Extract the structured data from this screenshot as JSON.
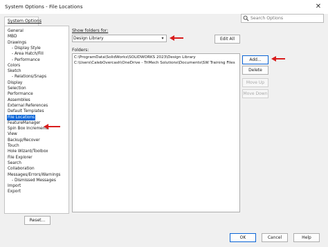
{
  "window": {
    "title": "System Options - File Locations",
    "close_glyph": "✕"
  },
  "tab": {
    "label": "System Options"
  },
  "search": {
    "placeholder": "Search Options"
  },
  "tree": {
    "items": [
      {
        "label": "General",
        "level": 0,
        "selected": false
      },
      {
        "label": "MBD",
        "level": 0,
        "selected": false
      },
      {
        "label": "Drawings",
        "level": 0,
        "selected": false
      },
      {
        "label": "Display Style",
        "level": 1,
        "selected": false
      },
      {
        "label": "Area Hatch/Fill",
        "level": 1,
        "selected": false
      },
      {
        "label": "Performance",
        "level": 1,
        "selected": false
      },
      {
        "label": "Colors",
        "level": 0,
        "selected": false
      },
      {
        "label": "Sketch",
        "level": 0,
        "selected": false
      },
      {
        "label": "Relations/Snaps",
        "level": 1,
        "selected": false
      },
      {
        "label": "Display",
        "level": 0,
        "selected": false
      },
      {
        "label": "Selection",
        "level": 0,
        "selected": false
      },
      {
        "label": "Performance",
        "level": 0,
        "selected": false
      },
      {
        "label": "Assemblies",
        "level": 0,
        "selected": false
      },
      {
        "label": "External References",
        "level": 0,
        "selected": false
      },
      {
        "label": "Default Templates",
        "level": 0,
        "selected": false
      },
      {
        "label": "File Locations",
        "level": 0,
        "selected": true
      },
      {
        "label": "FeatureManager",
        "level": 0,
        "selected": false
      },
      {
        "label": "Spin Box Increments",
        "level": 0,
        "selected": false
      },
      {
        "label": "View",
        "level": 0,
        "selected": false
      },
      {
        "label": "Backup/Recover",
        "level": 0,
        "selected": false
      },
      {
        "label": "Touch",
        "level": 0,
        "selected": false
      },
      {
        "label": "Hole Wizard/Toolbox",
        "level": 0,
        "selected": false
      },
      {
        "label": "File Explorer",
        "level": 0,
        "selected": false
      },
      {
        "label": "Search",
        "level": 0,
        "selected": false
      },
      {
        "label": "Collaboration",
        "level": 0,
        "selected": false
      },
      {
        "label": "Messages/Errors/Warnings",
        "level": 0,
        "selected": false
      },
      {
        "label": "Dismissed Messages",
        "level": 1,
        "selected": false
      },
      {
        "label": "Import",
        "level": 0,
        "selected": false
      },
      {
        "label": "Export",
        "level": 0,
        "selected": false
      }
    ]
  },
  "show_folders": {
    "label": "Show folders for:",
    "selected": "Design Library",
    "edit_all_label": "Edit All"
  },
  "folders": {
    "label": "Folders:",
    "entries": [
      "C:\\ProgramData\\SolidWorks\\SOLIDWORKS 2023\\Design Library",
      "C:\\Users\\CalebOvercash\\OneDrive - TriMech Solutions\\Documents\\SW Training Files"
    ]
  },
  "actions": {
    "add_label": "Add...",
    "delete_label": "Delete",
    "move_up_label": "Move Up",
    "move_down_label": "Move Down"
  },
  "footer": {
    "reset_label": "Reset...",
    "ok_label": "OK",
    "cancel_label": "Cancel",
    "help_label": "Help"
  },
  "colors": {
    "selection": "#0a64d6",
    "annotation_arrow": "#d91c1c",
    "background": "#f0f0f0"
  },
  "icons": {
    "app": "solidworks-options-icon",
    "search": "search-icon",
    "dropdown": "chevron-down-icon",
    "annotation": "red-arrow-icon"
  }
}
